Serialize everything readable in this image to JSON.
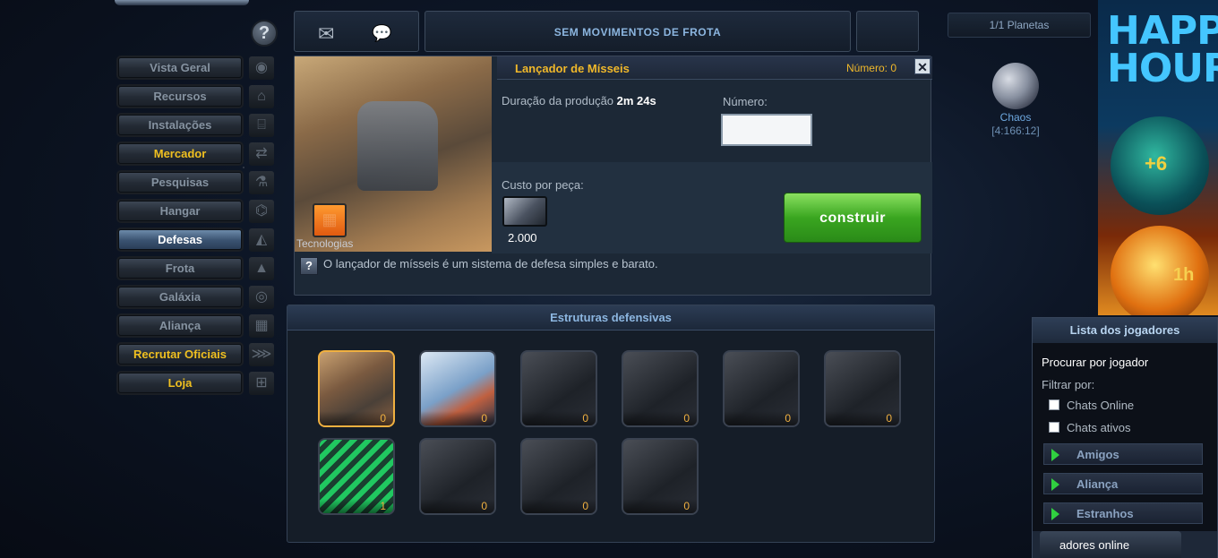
{
  "menu": [
    {
      "label": "Vista Geral",
      "style": "normal",
      "icon": "overview-icon",
      "glyph": "◉"
    },
    {
      "label": "Recursos",
      "style": "normal",
      "icon": "resources-icon",
      "glyph": "⌂"
    },
    {
      "label": "Instalações",
      "style": "normal",
      "icon": "facilities-icon",
      "glyph": "⌸"
    },
    {
      "label": "Mercador",
      "style": "gold",
      "icon": "merchant-icon",
      "glyph": "⇄"
    },
    {
      "label": "Pesquisas",
      "style": "normal",
      "icon": "research-icon",
      "glyph": "⚗"
    },
    {
      "label": "Hangar",
      "style": "normal",
      "icon": "shipyard-icon",
      "glyph": "⌬"
    },
    {
      "label": "Defesas",
      "style": "active",
      "icon": "defense-icon",
      "glyph": "◭"
    },
    {
      "label": "Frota",
      "style": "normal",
      "icon": "fleet-icon",
      "glyph": "▲"
    },
    {
      "label": "Galáxia",
      "style": "normal",
      "icon": "galaxy-icon",
      "glyph": "◎"
    },
    {
      "label": "Aliança",
      "style": "normal",
      "icon": "alliance-icon",
      "glyph": "▦"
    },
    {
      "label": "Recrutar Oficiais",
      "style": "gold",
      "icon": "officers-icon",
      "glyph": "⋙"
    },
    {
      "label": "Loja",
      "style": "gold",
      "icon": "shop-icon",
      "glyph": "⊞"
    }
  ],
  "topbar": {
    "fleet_status": "SEM MOVIMENTOS DE FROTA"
  },
  "planets": {
    "count": "1/1 Planetas",
    "name": "Chaos",
    "coords": "[4:166:12]"
  },
  "banner": {
    "text": "HAPPY HOUR",
    "boost1": "+6",
    "boost2": "1h"
  },
  "detail": {
    "title": "Lançador de Mísseis",
    "count": "Número: 0",
    "close": "✕",
    "tech_label": "Tecnologias",
    "duration_label": "Duração da produção",
    "duration_value": "2m 24s",
    "number_label": "Número:",
    "number_value": "",
    "cost_label": "Custo por peça:",
    "cost_value": "2.000",
    "build_button": "construir",
    "help": "?",
    "description": "O lançador de mísseis é um sistema de defesa simples e barato."
  },
  "defenses": {
    "title": "Estruturas defensivas",
    "items": [
      {
        "count": "0",
        "type": "selected"
      },
      {
        "count": "0",
        "type": "laser"
      },
      {
        "count": "0",
        "type": "normal"
      },
      {
        "count": "0",
        "type": "normal"
      },
      {
        "count": "0",
        "type": "normal"
      },
      {
        "count": "0",
        "type": "normal"
      },
      {
        "count": "1",
        "type": "ion"
      },
      {
        "count": "0",
        "type": "normal"
      },
      {
        "count": "0",
        "type": "normal"
      },
      {
        "count": "0",
        "type": "normal"
      }
    ]
  },
  "players": {
    "title": "Lista dos jogadores",
    "search": "Procurar por jogador",
    "filter": "Filtrar por:",
    "chk1": "Chats Online",
    "chk2": "Chats ativos",
    "groups": [
      "Amigos",
      "Aliança",
      "Estranhos"
    ],
    "online": "adores online"
  }
}
